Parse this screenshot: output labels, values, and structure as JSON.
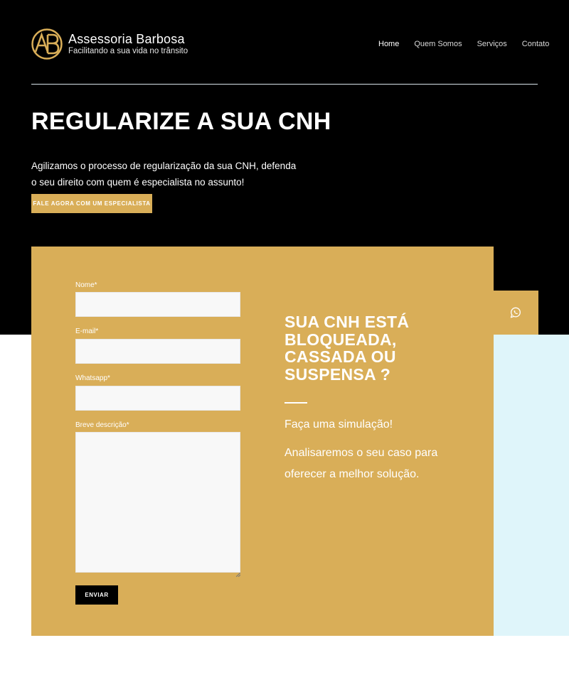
{
  "brand": {
    "logo_text": "AB",
    "title": "Assessoria Barbosa",
    "subtitle": "Facilitando a sua vida no trânsito",
    "accent_color": "#d9ae58"
  },
  "nav": {
    "items": [
      {
        "label": "Home",
        "active": true
      },
      {
        "label": "Quem Somos"
      },
      {
        "label": "Serviços"
      },
      {
        "label": "Contato"
      }
    ]
  },
  "hero": {
    "title": "REGULARIZE A SUA CNH",
    "text": "Agilizamos o processo de regularização da sua CNH, defenda o seu direito com quem é especialista no assunto!",
    "cta_label": "FALE AGORA COM UM ESPECIALISTA"
  },
  "form": {
    "name_label": "Nome*",
    "email_label": "E-mail*",
    "whatsapp_label": "Whatsapp*",
    "description_label": "Breve descrição*",
    "name_value": "",
    "email_value": "",
    "whatsapp_value": "",
    "description_value": "",
    "submit_label": "ENVIAR"
  },
  "promo": {
    "title": "SUA CNH ESTÁ BLOQUEADA, CASSADA OU SUSPENSA ?",
    "subtitle": "Faça uma simulação!",
    "text": "Analisaremos o seu caso para oferecer a melhor solução."
  },
  "whatsapp_button": {
    "icon": "whatsapp-icon"
  },
  "colors": {
    "dark": "#000000",
    "light_blue": "#dff5fa",
    "white": "#ffffff"
  }
}
